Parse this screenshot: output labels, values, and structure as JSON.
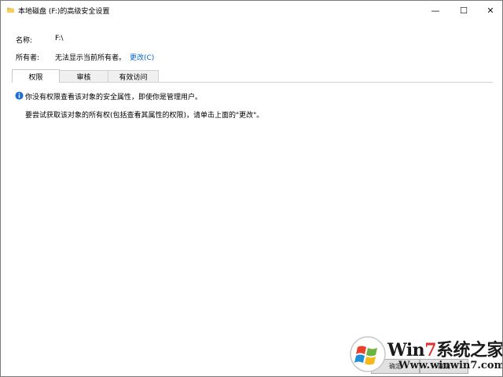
{
  "window": {
    "title": "本地磁盘 (F:)的高级安全设置",
    "icon": "folder-icon",
    "controls": {
      "minimize": "—",
      "maximize": "☐",
      "close": "✕"
    }
  },
  "fields": {
    "name_label": "名称:",
    "name_value": "F:\\",
    "owner_label": "所有者:",
    "owner_value": "无法显示当前所有者。",
    "change_link": "更改(C)"
  },
  "tabs": [
    {
      "label": "权限",
      "active": true
    },
    {
      "label": "审核",
      "active": false
    },
    {
      "label": "有效访问",
      "active": false
    }
  ],
  "content": {
    "info_icon": "info-icon",
    "info_text": "你没有权限查看该对象的安全属性，即使你是管理用户。",
    "hint_text": "要尝试获取该对象的所有权(包括查看其属性的权限)，请单击上面的\"更改\"。"
  },
  "footer": {
    "ok_label": "确定",
    "cancel_label": "取消"
  },
  "watermark": {
    "brand_prefix": "Win",
    "brand_seven": "7",
    "brand_suffix": "系统之家",
    "url": "Www.winwin7.com"
  },
  "colors": {
    "link": "#0066cc",
    "info_icon": "#1a6fd0",
    "folder_icon": "#e8b84a",
    "tab_border": "#d0d0d0"
  }
}
